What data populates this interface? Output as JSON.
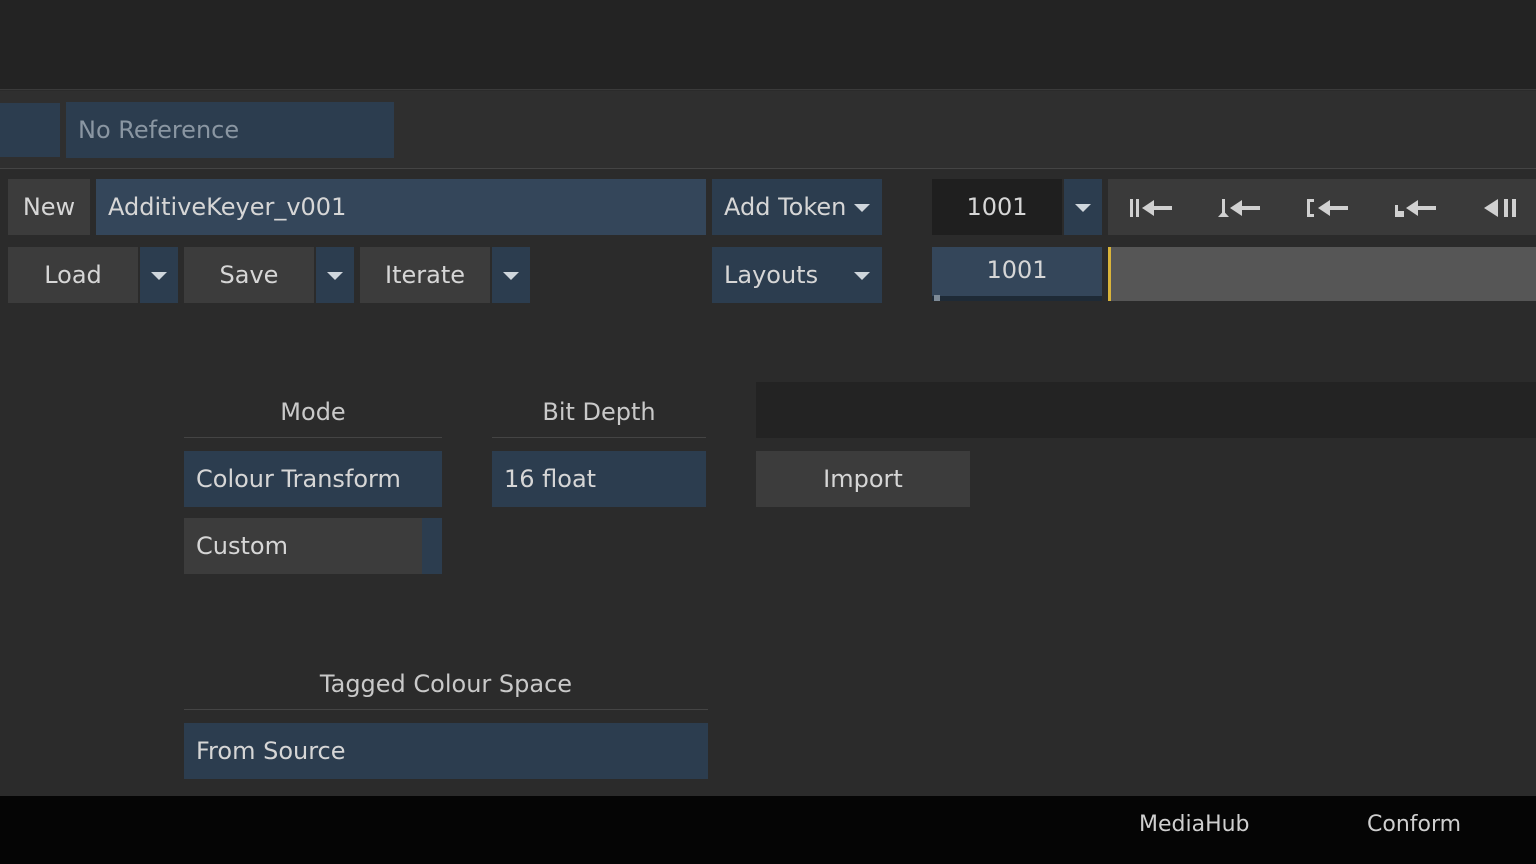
{
  "reference": {
    "value": "No Reference"
  },
  "toolbar": {
    "new_label": "New",
    "name_value": "AdditiveKeyer_v001",
    "add_token_label": "Add Token",
    "load_label": "Load",
    "save_label": "Save",
    "iterate_label": "Iterate",
    "layouts_label": "Layouts"
  },
  "transport": {
    "frame_value": "1001",
    "timeline_frame": "1001"
  },
  "settings": {
    "mode_label": "Mode",
    "mode_value": "Colour Transform",
    "custom_value": "Custom",
    "bit_depth_label": "Bit Depth",
    "bit_depth_value": "16 float",
    "import_label": "Import",
    "tagged_colour_space_label": "Tagged Colour Space",
    "tagged_colour_space_value": "From Source"
  },
  "footer": {
    "tabs": [
      "MediaHub",
      "Conform"
    ]
  }
}
